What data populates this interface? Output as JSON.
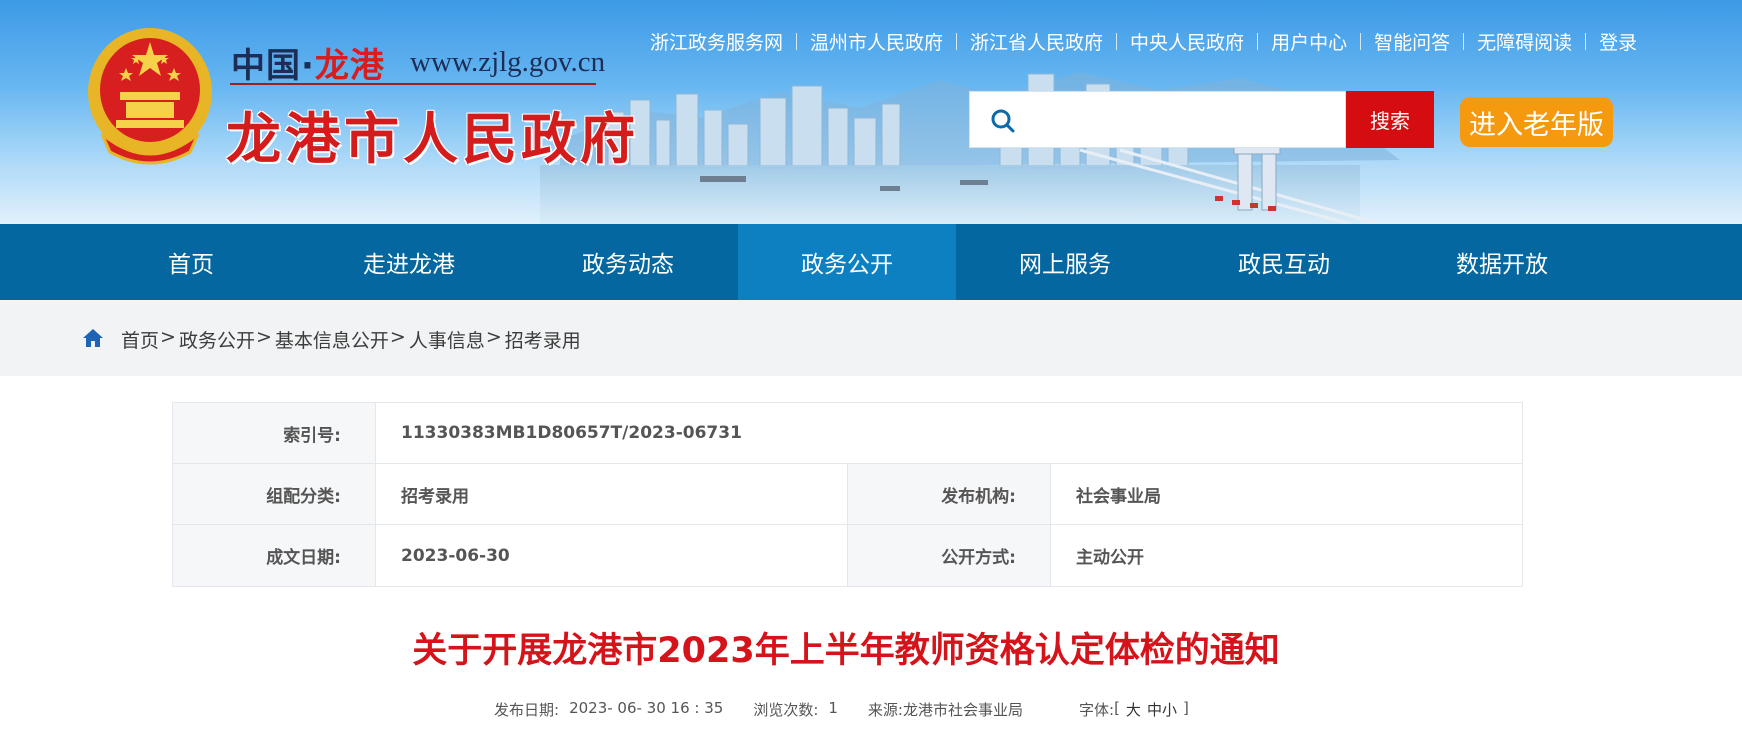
{
  "site": {
    "name_prefix": "中国·",
    "name_region": "龙港",
    "url": "www.zjlg.gov.cn",
    "name_full": "龙港市人民政府"
  },
  "top_links": [
    "浙江政务服务网",
    "温州市人民政府",
    "浙江省人民政府",
    "中央人民政府",
    "用户中心",
    "智能问答",
    "无障碍阅读",
    "登录"
  ],
  "search": {
    "placeholder": "",
    "button": "搜索",
    "icon": "search-icon"
  },
  "elder_mode": "进入老年版",
  "nav": {
    "items": [
      "首页",
      "走进龙港",
      "政务动态",
      "政务公开",
      "网上服务",
      "政民互动",
      "数据开放"
    ],
    "active": "政务公开"
  },
  "breadcrumb": {
    "icon": "home-icon",
    "items": [
      "首页",
      "政务公开",
      "基本信息公开",
      "人事信息",
      "招考录用"
    ],
    "separator": ">"
  },
  "meta": {
    "index_label": "索引号:",
    "index_value": "11330383MB1D80657T/2023-06731",
    "category_label": "组配分类:",
    "category_value": "招考录用",
    "publisher_label": "发布机构:",
    "publisher_value": "社会事业局",
    "date_label": "成文日期:",
    "date_value": "2023-06-30",
    "mode_label": "公开方式:",
    "mode_value": "主动公开"
  },
  "article": {
    "title": "关于开展龙港市2023年上半年教师资格认定体检的通知",
    "publish_label": "发布日期:",
    "publish_value": "2023- 06- 30 16 : 35",
    "views_label": "浏览次数:",
    "views_value": "1",
    "source_label": "来源:",
    "source_value": "龙港市社会事业局",
    "fontsize_label": "字体:",
    "fontsize_open": "[",
    "fontsize_large": "大",
    "fontsize_medium": "中",
    "fontsize_small": "小",
    "fontsize_close": "]"
  },
  "colors": {
    "nav_bg": "#05679f",
    "nav_active": "#0d80c1",
    "search_button": "#d60d10",
    "elder_button": "#f59a0e",
    "title_red": "#d4141a"
  }
}
